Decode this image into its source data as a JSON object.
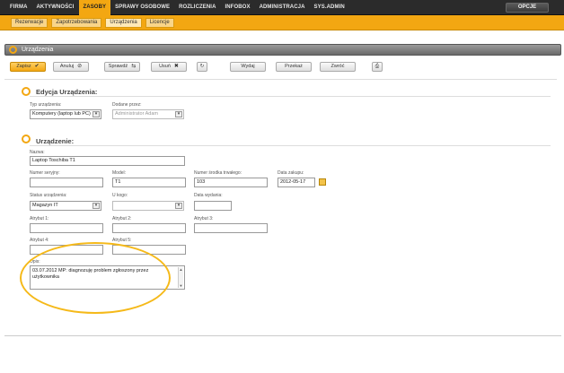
{
  "topnav": {
    "items": [
      "FIRMA",
      "AKTYWNOŚCI",
      "ZASOBY",
      "SPRAWY OSOBOWE",
      "ROZLICZENIA",
      "INFOBOX",
      "ADMINISTRACJA",
      "SYS.ADMIN"
    ],
    "active_index": 2,
    "options_label": "OPCJE"
  },
  "subnav": {
    "items": [
      "Rezerwacje",
      "Zapotrzebowania",
      "Urządzenia",
      "Licencje"
    ],
    "active_index": 2
  },
  "panel": {
    "title": "Urządzenia"
  },
  "toolbar": {
    "save": "Zapisz",
    "cancel": "Anuluj",
    "check": "Sprawdź",
    "delete": "Usuń",
    "issue": "Wydaj",
    "transfer": "Przekaż",
    "return": "Zwróć"
  },
  "edit_section": {
    "title": "Edycja Urządzenia:",
    "device_type_label": "Typ urządzenia:",
    "device_type_value": "Komputery (laptop lub PC)",
    "added_by_label": "Dodane przez:",
    "added_by_value": "Administrator Adam"
  },
  "device_section": {
    "title": "Urządzenie:",
    "name_label": "Nazwa:",
    "name_value": "Laptop Toschiba T1",
    "serial_label": "Numer seryjny:",
    "serial_value": "",
    "model_label": "Model:",
    "model_value": "T1",
    "asset_label": "Numer środka trwałego:",
    "asset_value": "103",
    "purchase_label": "Data zakupu:",
    "purchase_value": "2012-05-17",
    "status_label": "Status urządzenia:",
    "status_value": "Magazyn IT",
    "holder_label": "U kogo:",
    "holder_value": "",
    "issue_date_label": "Data wydania:",
    "issue_date_value": "",
    "attr1_label": "Atrybut 1:",
    "attr2_label": "Atrybut 2:",
    "attr3_label": "Atrybut 3:",
    "attr4_label": "Atrybut 4:",
    "attr5_label": "Atrybut 5:",
    "description_label": "Opis:",
    "description_value": "03.07.2012 MP: diagnozuję problem zgłoszony przez użytkownika"
  },
  "colors": {
    "accent": "#f3a712",
    "topbar": "#2b2b2b",
    "annotation": "#f5b919"
  }
}
